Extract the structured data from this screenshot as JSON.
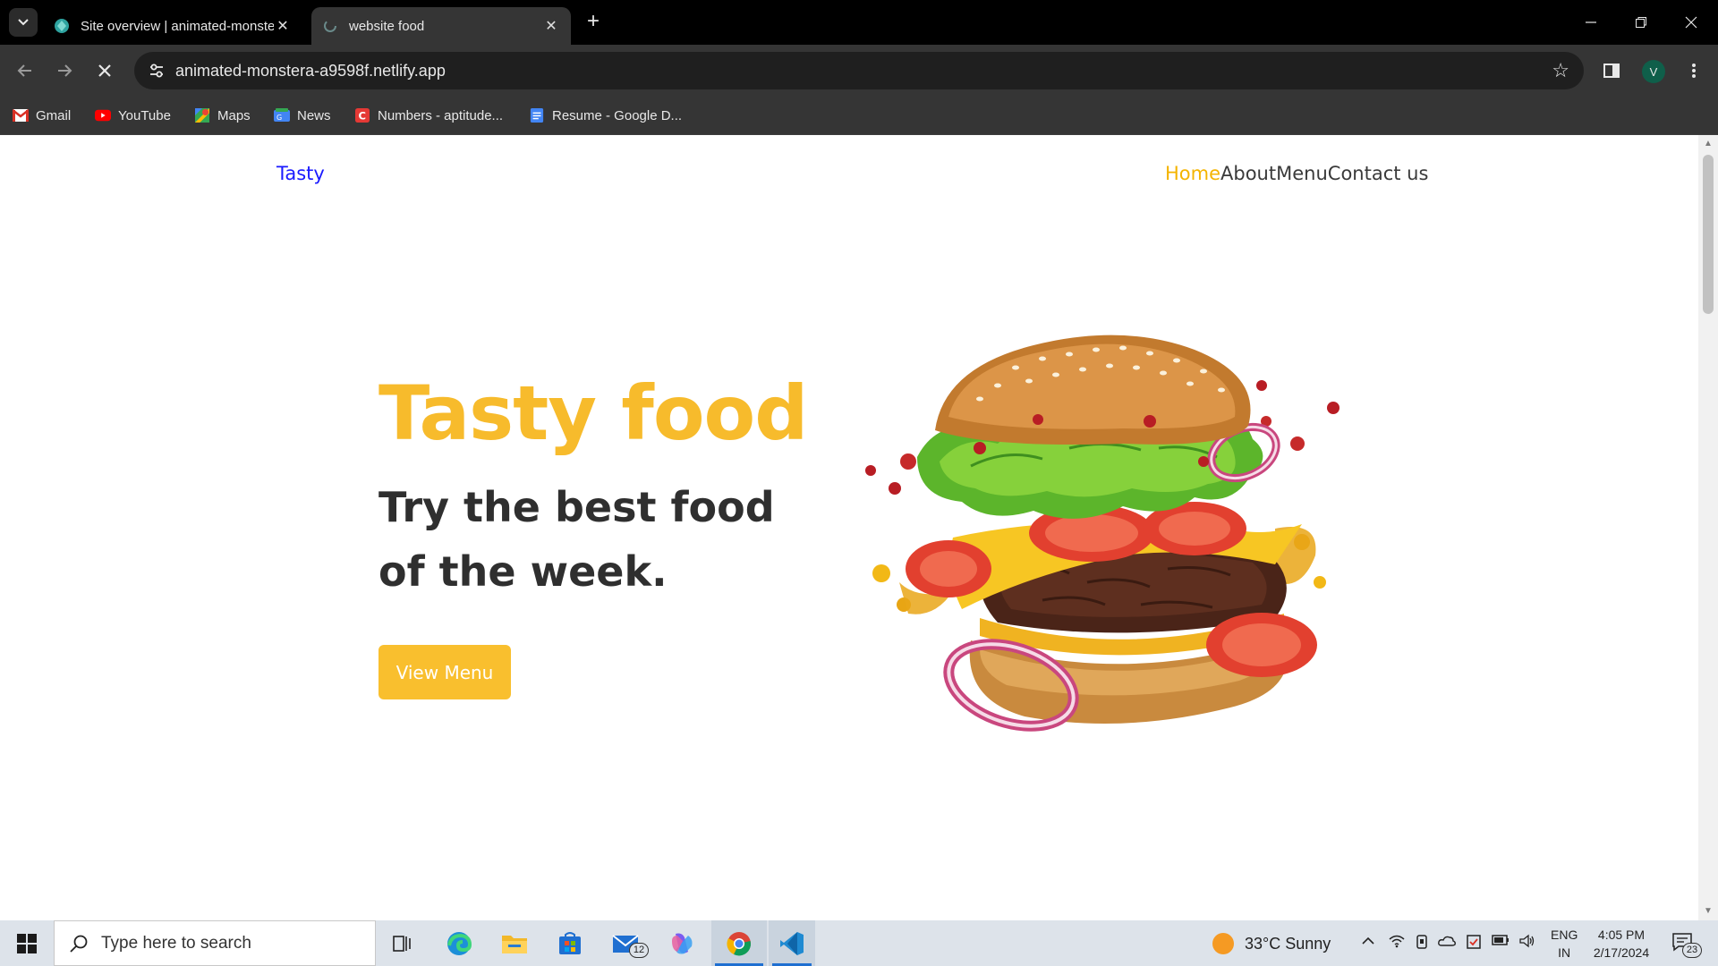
{
  "browser": {
    "tabs": [
      {
        "title": "Site overview | animated-monstera",
        "active": false
      },
      {
        "title": "website food",
        "active": true
      }
    ],
    "address": "animated-monstera-a9598f.netlify.app",
    "profile_initial": "V",
    "bookmarks": [
      {
        "label": "Gmail",
        "icon": "gmail-icon"
      },
      {
        "label": "YouTube",
        "icon": "youtube-icon"
      },
      {
        "label": "Maps",
        "icon": "maps-icon"
      },
      {
        "label": "News",
        "icon": "news-icon"
      },
      {
        "label": "Numbers - aptitude...",
        "icon": "c-icon"
      },
      {
        "label": "Resume - Google D...",
        "icon": "docs-icon"
      }
    ]
  },
  "site": {
    "logo": "Tasty",
    "nav": [
      "Home",
      "About",
      "Menu",
      "Contact us"
    ],
    "active_nav": "Home",
    "hero_title": "Tasty food",
    "hero_subtitle": "Try the best food of the week.",
    "cta": "View Menu",
    "colors": {
      "accent": "#f7bb2c",
      "logo": "#1a1aff",
      "text": "#2f2f2f"
    }
  },
  "taskbar": {
    "search_placeholder": "Type here to search",
    "weather": "33°C  Sunny",
    "lang_1": "ENG",
    "lang_2": "IN",
    "time": "4:05 PM",
    "date": "2/17/2024",
    "mail_badge": "12",
    "notif_badge": "23"
  }
}
